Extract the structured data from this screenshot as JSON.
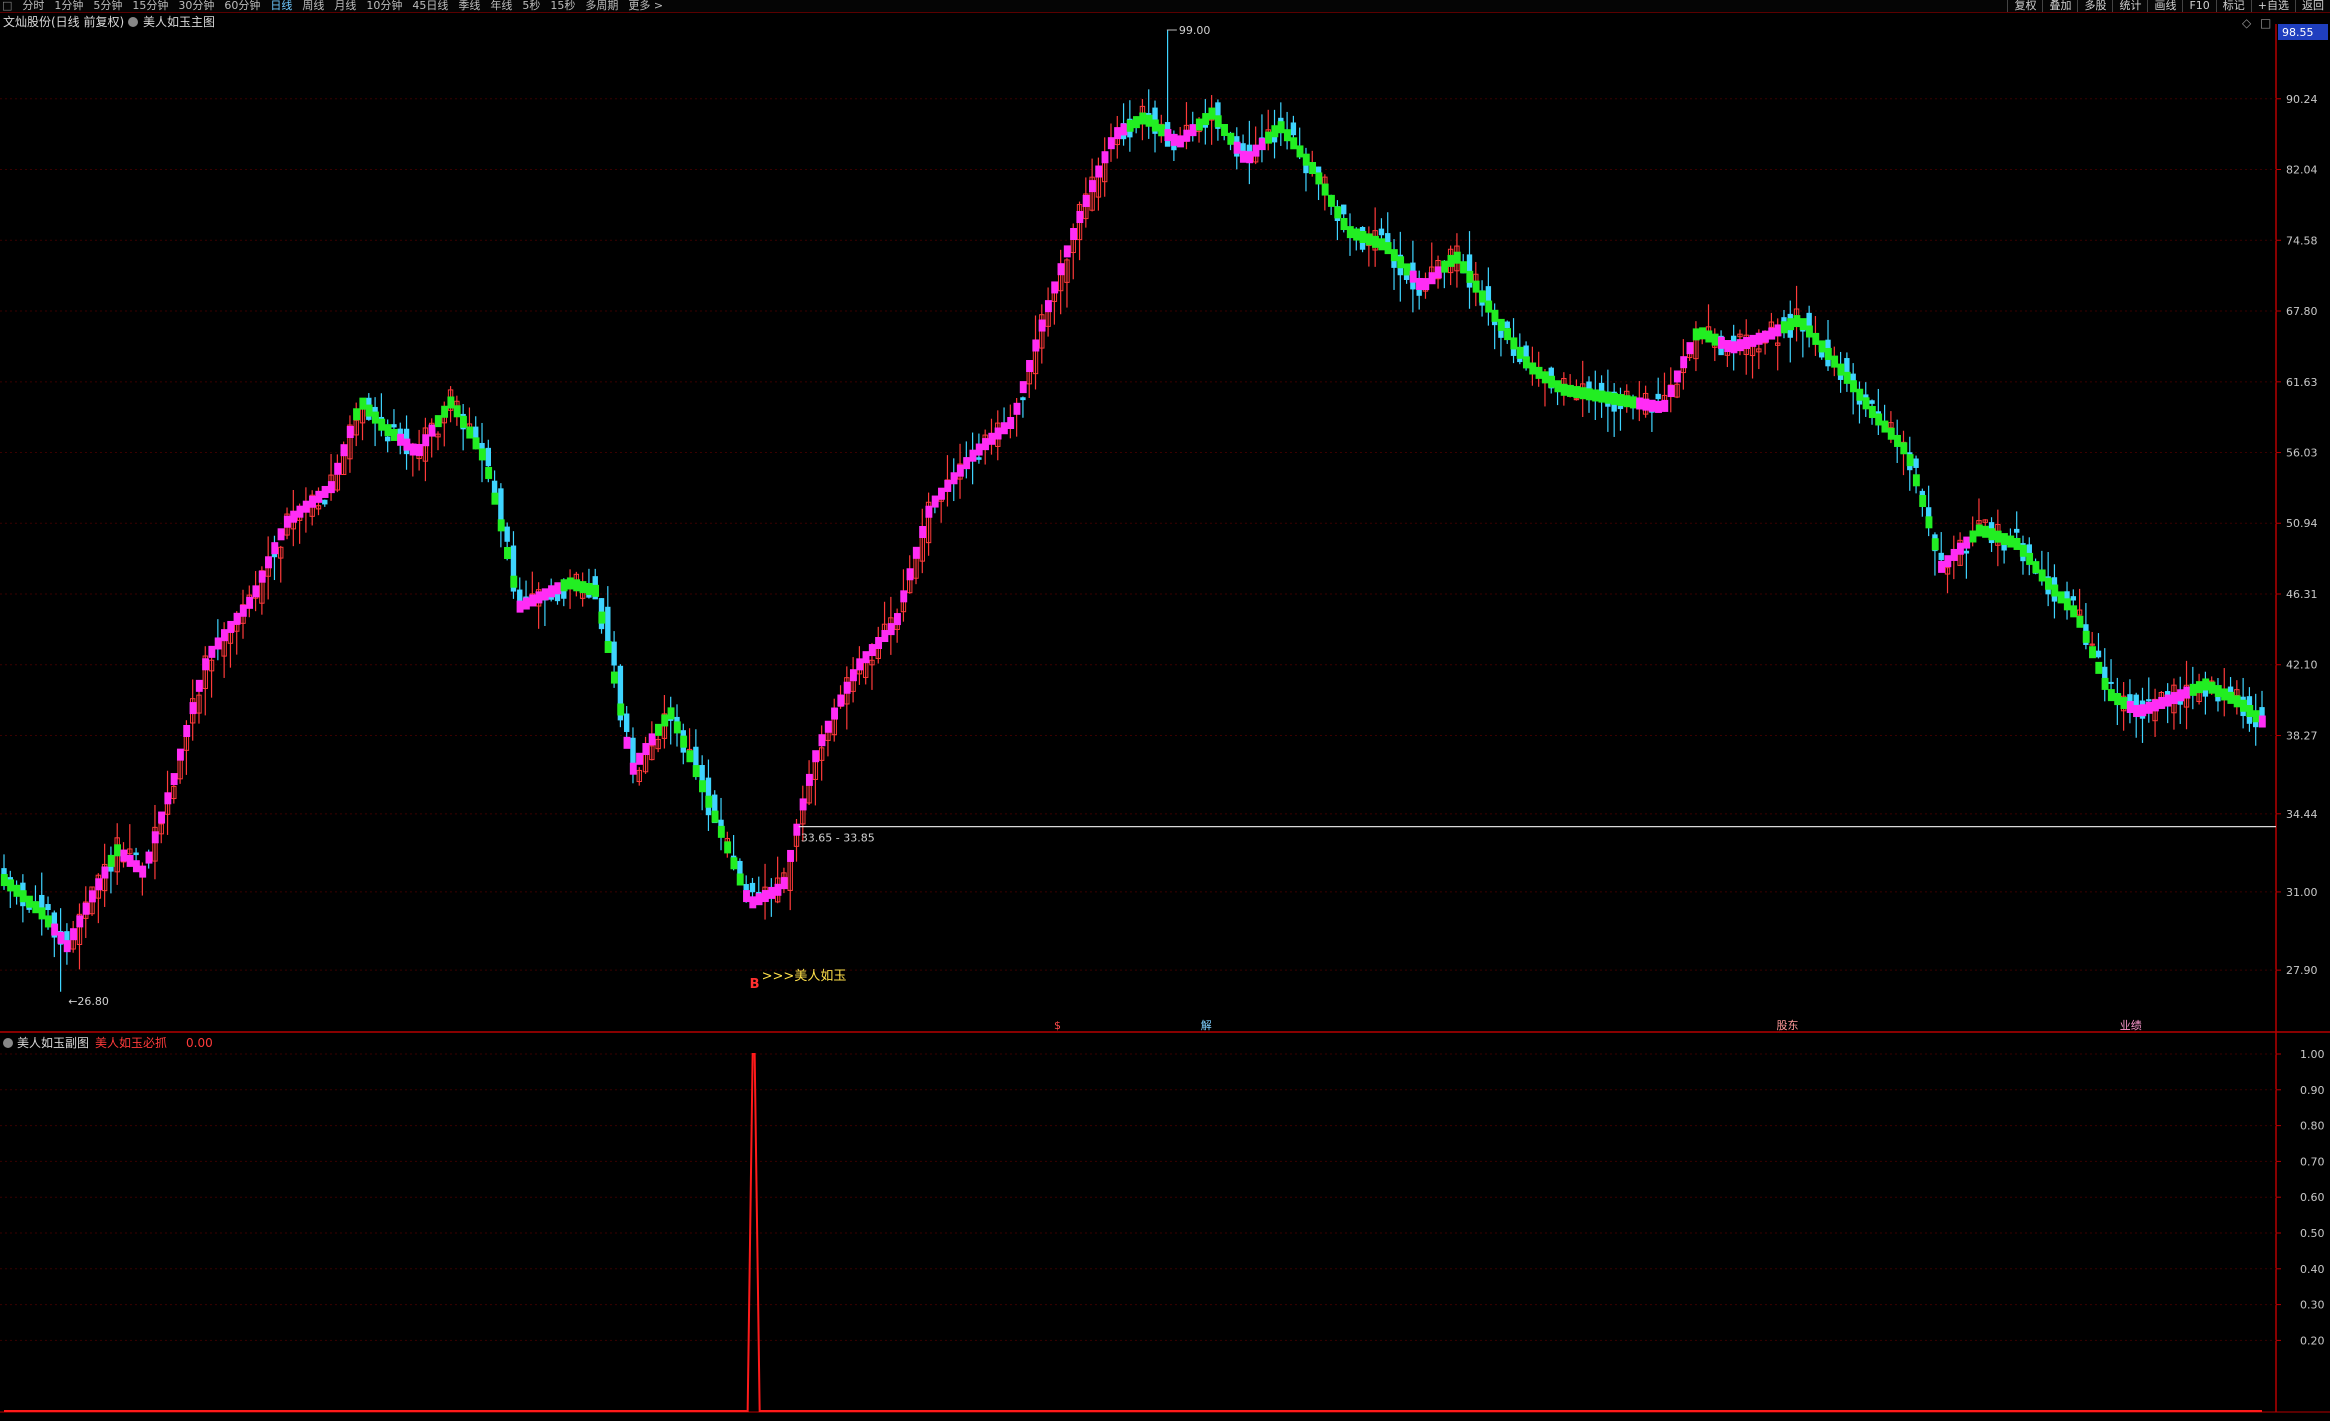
{
  "toolbar": {
    "lead_glyph": "□",
    "tabs": [
      {
        "label": "分时"
      },
      {
        "label": "1分钟"
      },
      {
        "label": "5分钟"
      },
      {
        "label": "15分钟"
      },
      {
        "label": "30分钟"
      },
      {
        "label": "60分钟"
      },
      {
        "label": "日线",
        "active": true
      },
      {
        "label": "周线"
      },
      {
        "label": "月线"
      },
      {
        "label": "10分钟"
      },
      {
        "label": "45日线"
      },
      {
        "label": "季线"
      },
      {
        "label": "年线"
      },
      {
        "label": "5秒"
      },
      {
        "label": "15秒"
      },
      {
        "label": "多周期"
      },
      {
        "label": "更多 >"
      }
    ],
    "right_buttons": [
      {
        "label": "复权"
      },
      {
        "label": "叠加"
      },
      {
        "label": "多股"
      },
      {
        "label": "统计"
      },
      {
        "label": "画线"
      },
      {
        "label": "F10"
      },
      {
        "label": "标记"
      },
      {
        "label": "+自选"
      },
      {
        "label": "返回"
      }
    ]
  },
  "main_panel": {
    "title": "文灿股份(日线 前复权)",
    "indicator": "美人如玉主图",
    "top_right_value": "98.55",
    "price_axis": [
      "90.24",
      "82.04",
      "74.58",
      "67.80",
      "61.63",
      "56.03",
      "50.94",
      "46.31",
      "42.10",
      "38.27",
      "34.44",
      "31.00",
      "27.90"
    ],
    "high_label": "99.00",
    "low_label": "←26.80",
    "range_label": "33.65 - 33.85",
    "signal_label": ">>>美人如玉",
    "signal_marker": "B",
    "bottom_markers": [
      {
        "text": "$",
        "color": "#ff4a4a"
      },
      {
        "text": "解",
        "color": "#7fd0ff"
      },
      {
        "text": "股东",
        "color": "#ff9a9a"
      },
      {
        "text": "业绩",
        "color": "#ff9ad0"
      }
    ]
  },
  "sub_panel": {
    "title": "美人如玉副图",
    "series_label": "美人如玉必抓",
    "series_value": "0.00",
    "axis": [
      "1.00",
      "0.90",
      "0.80",
      "0.70",
      "0.60",
      "0.50",
      "0.40",
      "0.30",
      "0.20"
    ]
  },
  "colors": {
    "up": "#ff3a3a",
    "down": "#3fd4ff",
    "trend_up": "#ff2df5",
    "trend_down": "#22ee22",
    "axis": "#b50000",
    "grid": "#3a0000"
  },
  "chart_data": {
    "type": "candlestick",
    "price_range": [
      26.8,
      99.0
    ],
    "high": 99.0,
    "low": 26.8,
    "y_ticks": [
      90.24,
      82.04,
      74.58,
      67.8,
      61.63,
      56.03,
      50.94,
      46.31,
      42.1,
      38.27,
      34.44,
      31.0,
      27.9
    ],
    "support_level": 33.85,
    "close_path": [
      {
        "t": 0,
        "v": 31.5
      },
      {
        "t": 0.016,
        "v": 30.2
      },
      {
        "t": 0.028,
        "v": 28.8
      },
      {
        "t": 0.04,
        "v": 31.0
      },
      {
        "t": 0.05,
        "v": 32.8
      },
      {
        "t": 0.062,
        "v": 31.8
      },
      {
        "t": 0.075,
        "v": 36.0
      },
      {
        "t": 0.09,
        "v": 42.5
      },
      {
        "t": 0.11,
        "v": 46.0
      },
      {
        "t": 0.125,
        "v": 51.0
      },
      {
        "t": 0.145,
        "v": 53.5
      },
      {
        "t": 0.158,
        "v": 60.0
      },
      {
        "t": 0.168,
        "v": 58.0
      },
      {
        "t": 0.183,
        "v": 56.0
      },
      {
        "t": 0.198,
        "v": 60.0
      },
      {
        "t": 0.213,
        "v": 55.5
      },
      {
        "t": 0.228,
        "v": 45.5
      },
      {
        "t": 0.25,
        "v": 47.0
      },
      {
        "t": 0.262,
        "v": 46.5
      },
      {
        "t": 0.278,
        "v": 36.5
      },
      {
        "t": 0.295,
        "v": 39.5
      },
      {
        "t": 0.312,
        "v": 35.0
      },
      {
        "t": 0.33,
        "v": 30.5
      },
      {
        "t": 0.345,
        "v": 31.2
      },
      {
        "t": 0.36,
        "v": 37.5
      },
      {
        "t": 0.378,
        "v": 42.0
      },
      {
        "t": 0.395,
        "v": 44.5
      },
      {
        "t": 0.41,
        "v": 52.0
      },
      {
        "t": 0.43,
        "v": 56.0
      },
      {
        "t": 0.447,
        "v": 58.5
      },
      {
        "t": 0.462,
        "v": 68.0
      },
      {
        "t": 0.478,
        "v": 78.0
      },
      {
        "t": 0.492,
        "v": 86.0
      },
      {
        "t": 0.505,
        "v": 88.0
      },
      {
        "t": 0.52,
        "v": 85.0
      },
      {
        "t": 0.535,
        "v": 88.5
      },
      {
        "t": 0.55,
        "v": 83.0
      },
      {
        "t": 0.565,
        "v": 87.0
      },
      {
        "t": 0.58,
        "v": 82.0
      },
      {
        "t": 0.595,
        "v": 75.5
      },
      {
        "t": 0.612,
        "v": 74.0
      },
      {
        "t": 0.628,
        "v": 70.0
      },
      {
        "t": 0.643,
        "v": 73.0
      },
      {
        "t": 0.658,
        "v": 68.0
      },
      {
        "t": 0.675,
        "v": 63.0
      },
      {
        "t": 0.69,
        "v": 61.0
      },
      {
        "t": 0.705,
        "v": 60.5
      },
      {
        "t": 0.72,
        "v": 60.0
      },
      {
        "t": 0.735,
        "v": 59.5
      },
      {
        "t": 0.75,
        "v": 66.0
      },
      {
        "t": 0.765,
        "v": 64.5
      },
      {
        "t": 0.78,
        "v": 65.5
      },
      {
        "t": 0.795,
        "v": 67.0
      },
      {
        "t": 0.812,
        "v": 63.0
      },
      {
        "t": 0.828,
        "v": 59.0
      },
      {
        "t": 0.843,
        "v": 56.0
      },
      {
        "t": 0.858,
        "v": 48.0
      },
      {
        "t": 0.875,
        "v": 50.5
      },
      {
        "t": 0.892,
        "v": 49.5
      },
      {
        "t": 0.905,
        "v": 47.0
      },
      {
        "t": 0.918,
        "v": 45.0
      },
      {
        "t": 0.932,
        "v": 40.5
      },
      {
        "t": 0.945,
        "v": 39.5
      },
      {
        "t": 0.96,
        "v": 40.2
      },
      {
        "t": 0.975,
        "v": 41.0
      },
      {
        "t": 0.99,
        "v": 40.0
      },
      {
        "t": 1,
        "v": 39.0
      }
    ],
    "sub_series": {
      "name": "美人如玉必抓",
      "y_range": [
        0,
        1
      ],
      "signal_at_t": 0.332,
      "signal_value": 1.0
    }
  }
}
